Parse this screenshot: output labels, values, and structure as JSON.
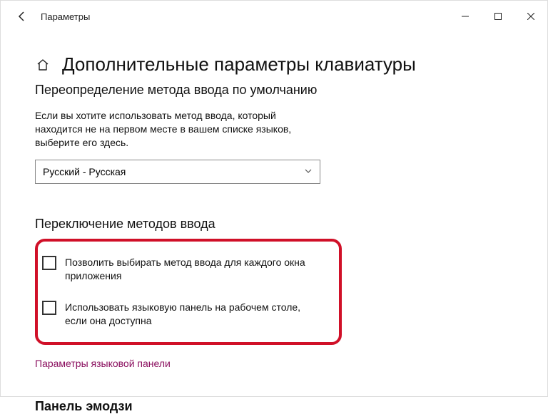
{
  "window": {
    "title": "Параметры"
  },
  "page": {
    "title": "Дополнительные параметры клавиатуры"
  },
  "section_override": {
    "title": "Переопределение метода ввода по умолчанию",
    "description": "Если вы хотите использовать метод ввода, который находится не на первом месте в вашем списке языков, выберите его здесь.",
    "selected": "Русский - Русская"
  },
  "section_switch": {
    "title": "Переключение методов ввода",
    "checkbox1": "Позволить выбирать метод ввода для каждого окна приложения",
    "checkbox2": "Использовать языковую панель на рабочем столе, если она доступна",
    "link": "Параметры языковой панели"
  },
  "section_emoji": {
    "title": "Панель эмодзи"
  }
}
